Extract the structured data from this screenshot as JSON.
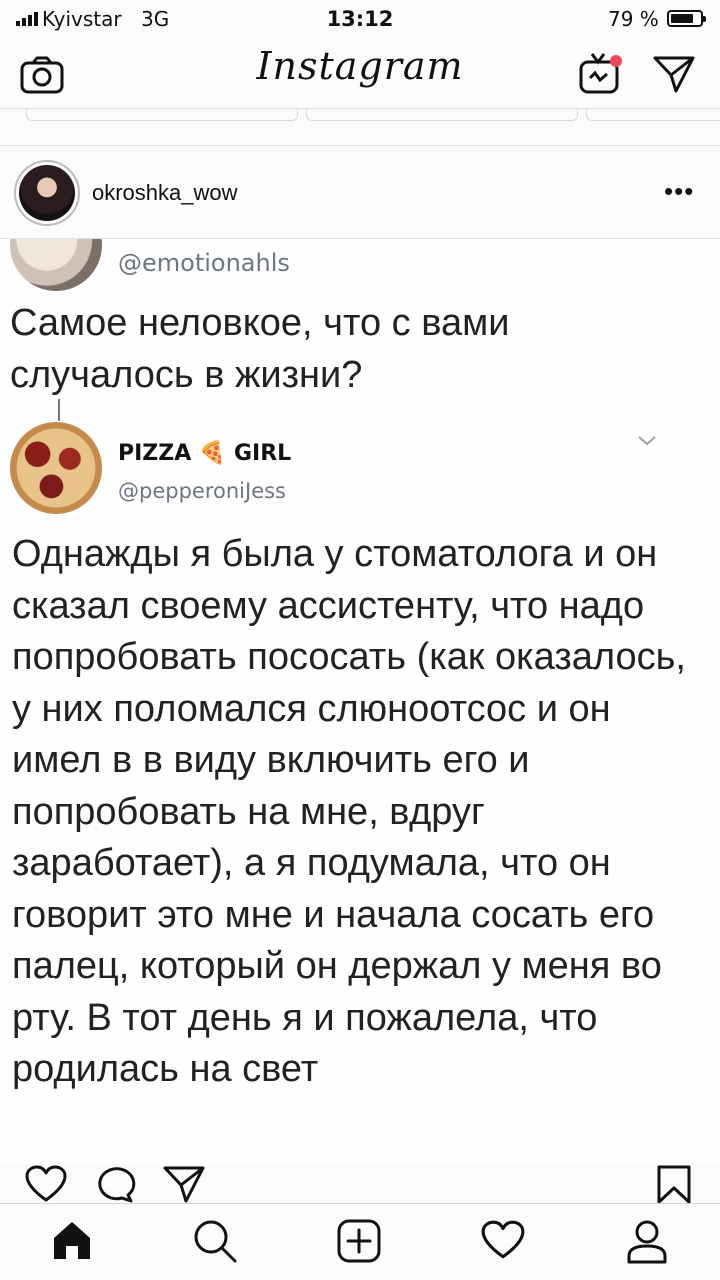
{
  "status_bar": {
    "carrier": "Kyivstar",
    "network": "3G",
    "time": "13:12",
    "battery_percent": "79 %",
    "battery_level": 0.79
  },
  "header": {
    "logo": "Instagram",
    "icons": [
      "camera-icon",
      "igtv-icon",
      "direct-message-icon"
    ]
  },
  "post": {
    "username": "okroshka_wow",
    "more_label": "•••",
    "tweet_quoted": {
      "handle": "@emotionahls",
      "text": "Самое неловкое, что с вами случалось в жизни?"
    },
    "tweet_reply": {
      "name": "PIZZA 🍕 GIRL",
      "handle": "@pepperoniJess",
      "text": "Однажды я была у стоматолога и он сказал своему ассистенту, что надо попробовать пососать (как оказалось, у них поломался слюноотсос и он имел в в виду включить его и попробовать на мне, вдруг заработает), а я подумала, что он говорит это мне и начала сосать его палец, который он держал у меня во рту. В тот день я и пожалела, что родилась на свет"
    },
    "actions": [
      "like-icon",
      "comment-icon",
      "share-icon",
      "save-icon"
    ]
  },
  "tab_bar": [
    "home-icon",
    "search-icon",
    "new-post-icon",
    "activity-icon",
    "profile-icon"
  ]
}
